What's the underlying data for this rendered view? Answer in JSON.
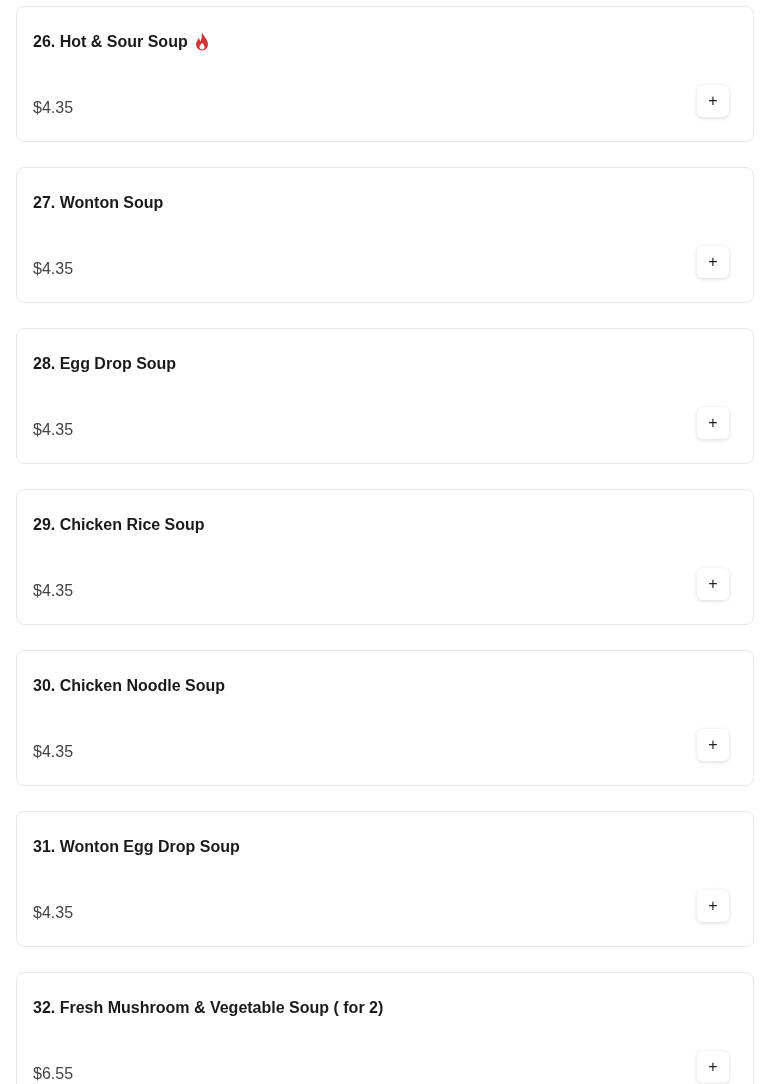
{
  "items": [
    {
      "name": "26. Hot & Sour Soup",
      "spicy": true,
      "price": "$4.35",
      "add_button": "+"
    },
    {
      "name": "27. Wonton Soup",
      "spicy": false,
      "price": "$4.35",
      "add_button": "+"
    },
    {
      "name": "28. Egg Drop Soup",
      "spicy": false,
      "price": "$4.35",
      "add_button": "+"
    },
    {
      "name": "29. Chicken Rice Soup",
      "spicy": false,
      "price": "$4.35",
      "add_button": "+"
    },
    {
      "name": "30. Chicken Noodle Soup",
      "spicy": false,
      "price": "$4.35",
      "add_button": "+"
    },
    {
      "name": "31. Wonton Egg Drop Soup",
      "spicy": false,
      "price": "$4.35",
      "add_button": "+"
    },
    {
      "name": "32. Fresh Mushroom & Vegetable Soup ( for 2)",
      "spicy": false,
      "price": "$6.55",
      "add_button": "+"
    }
  ]
}
